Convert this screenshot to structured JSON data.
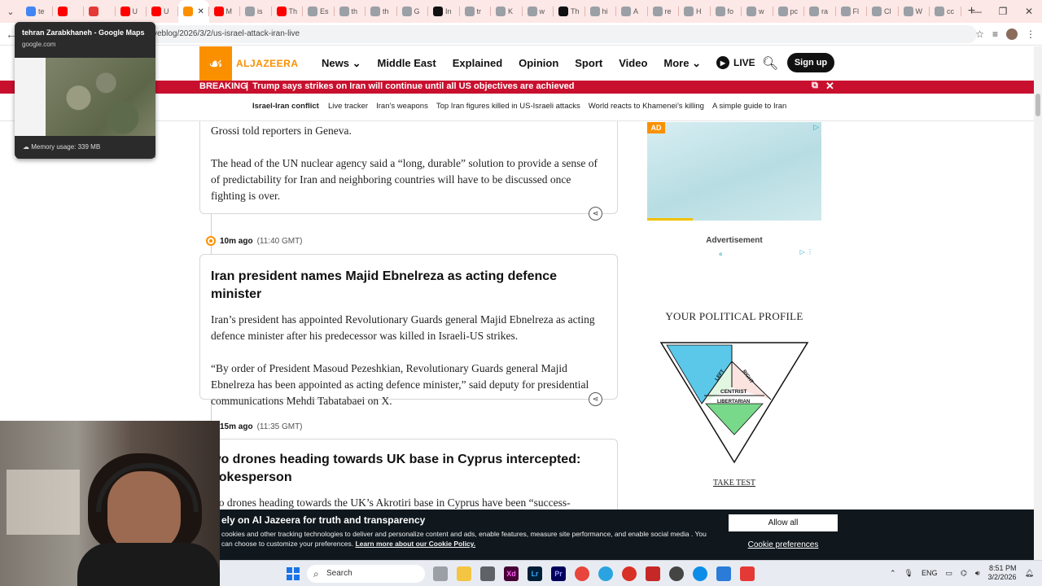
{
  "browser": {
    "tab_labels": [
      "te",
      "",
      "",
      "U",
      "U",
      "",
      "M",
      "is",
      "Th",
      "Es",
      "th",
      "th",
      "G",
      "In",
      "tr",
      "K",
      "w",
      "Th",
      "hi",
      "A",
      "re",
      "H",
      "fo",
      "w",
      "pc",
      "ra",
      "Fl",
      "Cl",
      "W",
      "cc"
    ],
    "url": "veblog/2026/3/2/us-israel-attack-iran-live",
    "tooltip": {
      "title": "tehran Zarabkhaneh - Google Maps",
      "domain": "google.com",
      "memory": "Memory usage: 339 MB"
    }
  },
  "site": {
    "logo_text": "ALJAZEERA",
    "nav": [
      "News",
      "Middle East",
      "Explained",
      "Opinion",
      "Sport",
      "Video",
      "More"
    ],
    "live": "LIVE",
    "signup": "Sign up",
    "breaking_label": "BREAKING",
    "breaking_text": "Trump says strikes on Iran will continue until all US objectives are achieved",
    "subnav_title": "Israel-Iran conflict",
    "subnav_links": [
      "Live tracker",
      "Iran’s weapons",
      "Top Iran figures killed in US-Israeli attacks",
      "World reacts to Khamenei’s killing",
      "A simple guide to Iran"
    ]
  },
  "feed": {
    "card1": {
      "p1": "Grossi told reporters in Geneva.",
      "p2": "The head of the UN nuclear agency said a “long, durable” solution to provide a sense of of predictability for Iran and neighboring countries will have to be dis­cussed once fighting is over."
    },
    "stamp2": {
      "ago": "10m ago",
      "time": "(11:40 GMT)"
    },
    "card2": {
      "headline": "Iran president names Majid Ebnelreza as acting defence minister",
      "p1": "Iran’s president has appointed Revolutionary Guards general Majid Ebnelreza as acting defence minister after his predecessor was killed in Israeli-US strikes.",
      "p2": "“By order of President Masoud Pezeshkian, Revolutionary Guards general Majid Ebnelreza has been appointed as acting defence minister,” said deputy for presi­dential communications Mehdi Tabatabaei on X."
    },
    "stamp3": {
      "ago": "15m ago",
      "time": "(11:35 GMT)"
    },
    "card3": {
      "headline": "wo drones heading towards UK base in Cyprus intercepted: pokesperson",
      "p1": "wo drones heading towards the UK’s Akrotiri base in Cyprus have been “success-"
    }
  },
  "sidebar": {
    "ad_badge": "AD",
    "ad_label": "Advertisement",
    "profile_title": "YOUR POLITICAL PROFILE",
    "take_test": "TAKE TEST",
    "triangle_labels": {
      "left": "LEFT",
      "right": "RIGHT",
      "centrist": "CENTRIST",
      "libertarian": "LIBERTARIAN"
    }
  },
  "cookie": {
    "title": "ely on Al Jazeera for truth and transparency",
    "body": "cookies and other tracking technologies to deliver and personalize content and ads, enable features, measure site performance, and enable social media . You can choose to customize your preferences.",
    "link": "Learn more about our Cookie Policy.",
    "allow": "Allow all",
    "prefs": "Cookie preferences"
  },
  "taskbar": {
    "search": "Search",
    "lang": "ENG",
    "time": "8:51 PM",
    "date": "3/2/2026"
  }
}
